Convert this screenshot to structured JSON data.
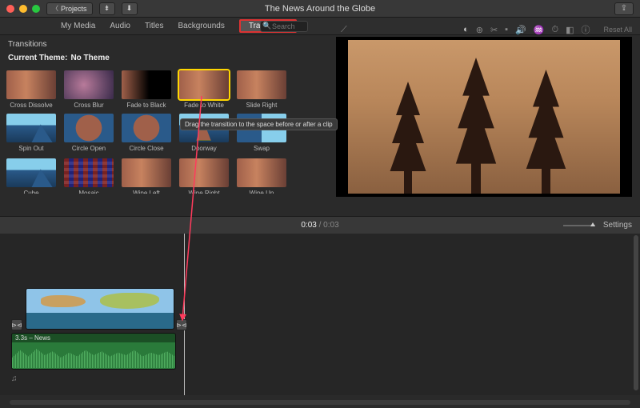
{
  "titlebar": {
    "project_btn": "Projects",
    "title": "The News Around the Globe"
  },
  "tabs": {
    "my_media": "My Media",
    "audio": "Audio",
    "titles": "Titles",
    "backgrounds": "Backgrounds",
    "transitions": "Transitions"
  },
  "search": {
    "placeholder": "Search"
  },
  "browser": {
    "section": "Transitions",
    "theme_label": "Current Theme:",
    "theme_value": "No Theme",
    "items": [
      {
        "label": "Cross Dissolve"
      },
      {
        "label": "Cross Blur"
      },
      {
        "label": "Fade to Black"
      },
      {
        "label": "Fade to White"
      },
      {
        "label": "Slide Right"
      },
      {
        "label": "Spin Out"
      },
      {
        "label": "Circle Open"
      },
      {
        "label": "Circle Close"
      },
      {
        "label": "Doorway"
      },
      {
        "label": "Swap"
      },
      {
        "label": "Cube"
      },
      {
        "label": "Mosaic"
      },
      {
        "label": "Wipe Left"
      },
      {
        "label": "Wipe Right"
      },
      {
        "label": "Wipe Up"
      }
    ]
  },
  "tooltip": "Drag the transition to the space before or after a clip",
  "preview_toolbar": {
    "reset": "Reset All"
  },
  "time": {
    "current": "0:03",
    "total": "0:03",
    "settings": "Settings"
  },
  "timeline": {
    "audio_label": "3.3s – News"
  }
}
